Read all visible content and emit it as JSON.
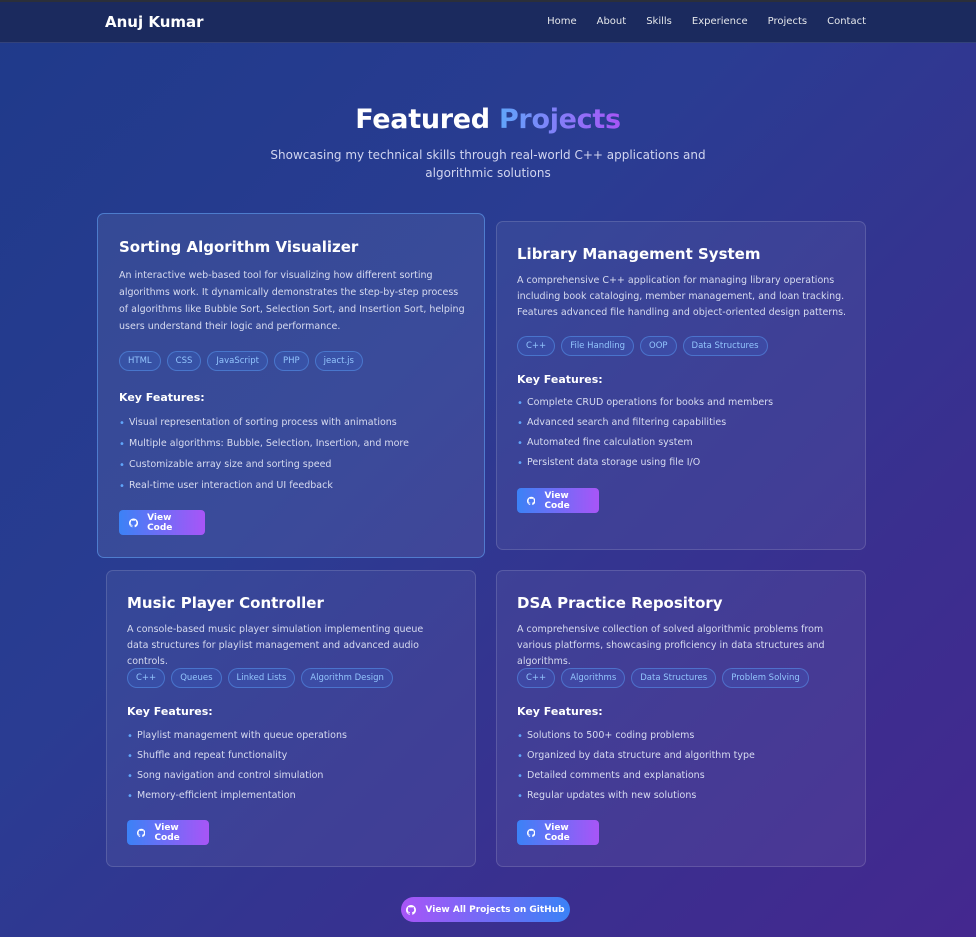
{
  "brand": "Anuj Kumar",
  "nav": [
    "Home",
    "About",
    "Skills",
    "Experience",
    "Projects",
    "Contact"
  ],
  "section": {
    "title_main": "Featured",
    "title_accent": "Projects",
    "subtitle": "Showcasing my technical skills through real-world C++ applications and algorithmic solutions"
  },
  "key_features_label": "Key Features:",
  "view_code_label": "View Code",
  "view_all_label": "View All Projects on GitHub",
  "projects": [
    {
      "title": "Sorting Algorithm Visualizer",
      "description": "An interactive web-based tool for visualizing how different sorting algorithms work. It dynamically demonstrates the step-by-step process of algorithms like Bubble Sort, Selection Sort, and Insertion Sort, helping users understand their logic and performance.",
      "tags": [
        "HTML",
        "CSS",
        "JavaScript",
        "PHP",
        "jeact.js"
      ],
      "features": [
        "Visual representation of sorting process with animations",
        "Multiple algorithms: Bubble, Selection, Insertion, and more",
        "Customizable array size and sorting speed",
        "Real-time user interaction and UI feedback"
      ]
    },
    {
      "title": "Library Management System",
      "description": "A comprehensive C++ application for managing library operations including book cataloging, member management, and loan tracking. Features advanced file handling and object-oriented design patterns.",
      "tags": [
        "C++",
        "File Handling",
        "OOP",
        "Data Structures"
      ],
      "features": [
        "Complete CRUD operations for books and members",
        "Advanced search and filtering capabilities",
        "Automated fine calculation system",
        "Persistent data storage using file I/O"
      ]
    },
    {
      "title": "Music Player Controller",
      "description": "A console-based music player simulation implementing queue data structures for playlist management and advanced audio controls.",
      "tags": [
        "C++",
        "Queues",
        "Linked Lists",
        "Algorithm Design"
      ],
      "features": [
        "Playlist management with queue operations",
        "Shuffle and repeat functionality",
        "Song navigation and control simulation",
        "Memory-efficient implementation"
      ]
    },
    {
      "title": "DSA Practice Repository",
      "description": "A comprehensive collection of solved algorithmic problems from various platforms, showcasing proficiency in data structures and algorithms.",
      "tags": [
        "C++",
        "Algorithms",
        "Data Structures",
        "Problem Solving"
      ],
      "features": [
        "Solutions to 500+ coding problems",
        "Organized by data structure and algorithm type",
        "Detailed comments and explanations",
        "Regular updates with new solutions"
      ]
    }
  ]
}
